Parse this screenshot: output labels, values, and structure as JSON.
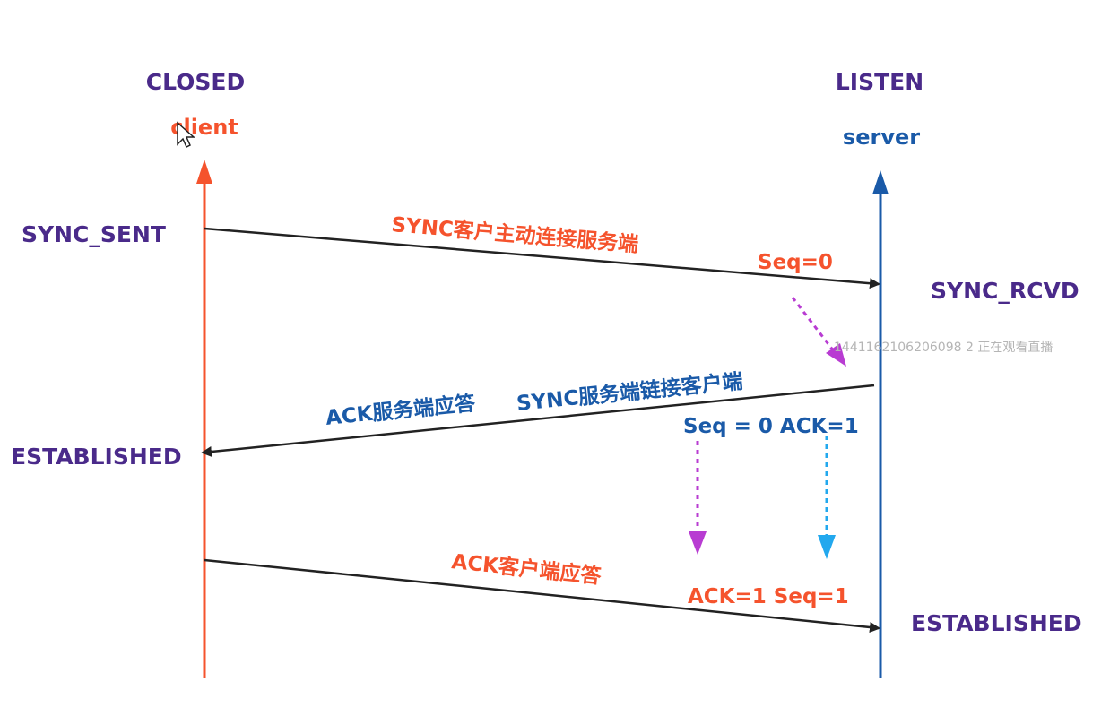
{
  "colors": {
    "client_line": "#f5532d",
    "server_line": "#1a5aa8",
    "arrow": "#222222",
    "state_text": "#4a2a8a",
    "magenta_dash": "#b83cd2",
    "cyan_dash": "#22a8ee"
  },
  "client": {
    "state_top": "CLOSED",
    "name": "client",
    "state_sent": "SYNC_SENT",
    "state_established": "ESTABLISHED"
  },
  "server": {
    "state_top": "LISTEN",
    "name": "server",
    "state_rcvd": "SYNC_RCVD",
    "state_established": "ESTABLISHED"
  },
  "messages": {
    "syn": {
      "label": "SYNC客户主动连接服务端",
      "seq": "Seq=0"
    },
    "syn_ack": {
      "label_ack": "ACK服务端应答",
      "label_syn": "SYNC服务端链接客户端",
      "seq_ack": "Seq = 0 ACK=1"
    },
    "ack": {
      "label": "ACK客户端应答",
      "ack_seq": "ACK=1 Seq=1"
    }
  },
  "watermark": "1441162106206098 2 正在观看直播",
  "icons": {
    "cursor": "mouse-pointer-icon"
  }
}
